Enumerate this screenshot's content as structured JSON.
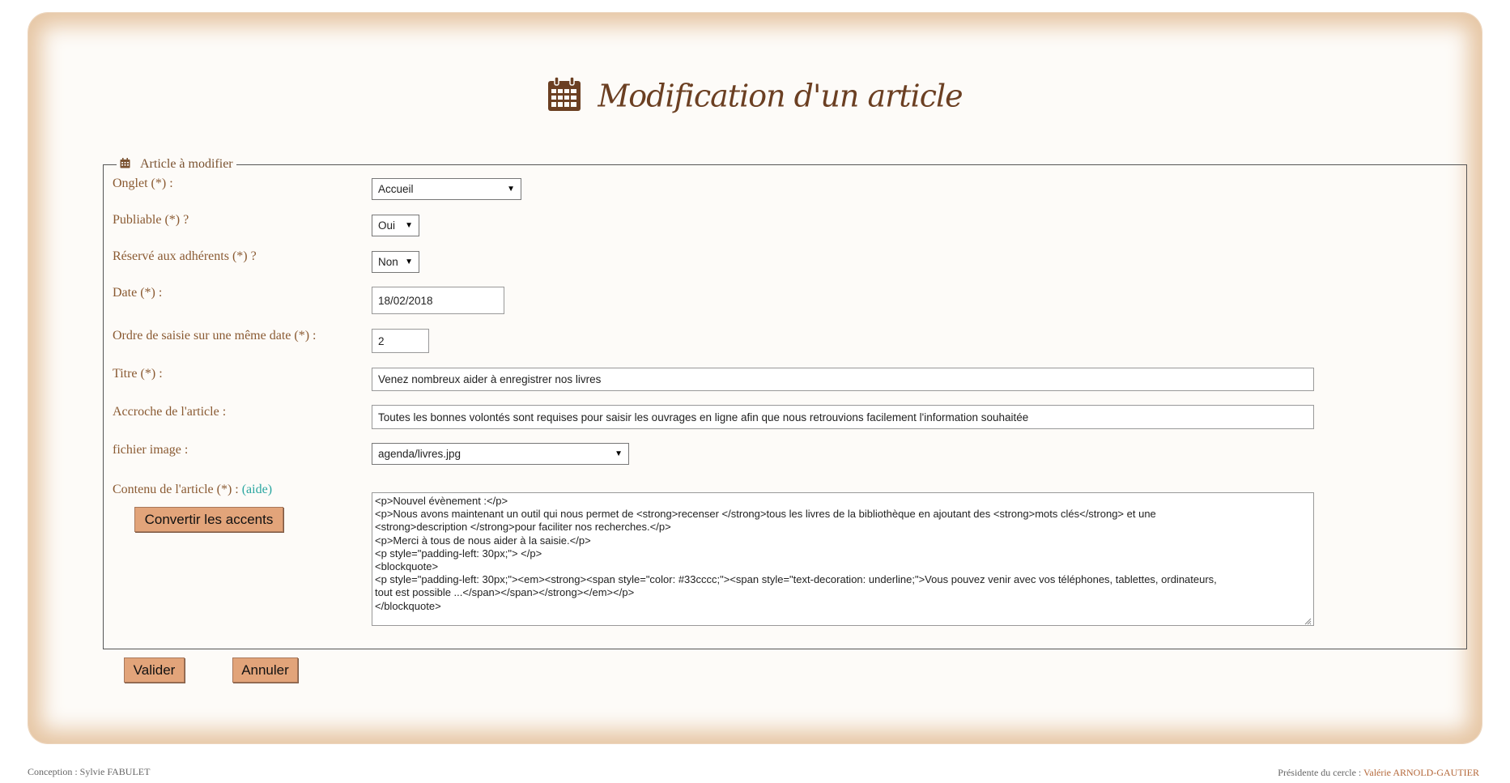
{
  "header": {
    "title": "Modification d'un article",
    "icon": "calendar-icon"
  },
  "fieldset": {
    "legend": "Article à modifier",
    "icon": "calendar-icon"
  },
  "form": {
    "onglet": {
      "label": "Onglet (*) :",
      "value": "Accueil"
    },
    "publiable": {
      "label": "Publiable (*) ?",
      "value": "Oui"
    },
    "reserve": {
      "label": "Réservé aux adhérents (*) ?",
      "value": "Non"
    },
    "date": {
      "label": "Date (*) :",
      "value": "18/02/2018"
    },
    "ordre": {
      "label": "Ordre de saisie sur une même date (*) :",
      "value": "2"
    },
    "titre": {
      "label": "Titre (*) :",
      "value": "Venez nombreux aider à enregistrer nos livres"
    },
    "accroche": {
      "label": "Accroche de l'article :",
      "value": "Toutes les bonnes volontés sont requises pour saisir les ouvrages en ligne afin que nous retrouvions facilement l'information souhaitée"
    },
    "image": {
      "label": "fichier image :",
      "value": "agenda/livres.jpg"
    },
    "contenu": {
      "label": "Contenu de l'article (*) : ",
      "aide": "(aide)",
      "convert_label": "Convertir les accents",
      "lines": [
        "<p>Nouvel évènement :</p>",
        "<p>Nous avons maintenant un outil qui nous permet de <strong>recenser </strong>tous les livres de la bibliothèque en ajoutant des <strong>mots clés</strong> et une",
        "<strong>description </strong>pour faciliter nos recherches.</p>",
        "<p>Merci à tous de nous aider à la saisie.</p>",
        "<p style=\"padding-left: 30px;\"> </p>",
        "<blockquote>",
        "<p style=\"padding-left: 30px;\"><em><strong><span style=\"color: #33cccc;\"><span style=\"text-decoration: underline;\">Vous pouvez venir avec vos téléphones, tablettes, ordinateurs,",
        "tout est possible ...</span></span></strong></em></p>",
        "</blockquote>"
      ]
    }
  },
  "actions": {
    "valider": "Valider",
    "annuler": "Annuler"
  },
  "footer": {
    "conception": "Conception : Sylvie FABULET",
    "president_label": "Présidente du cercle : ",
    "president_name": "Valérie ARNOLD-GAUTIER"
  },
  "colors": {
    "accent": "#e2a47a",
    "title": "#6b3f22",
    "label": "#8a5a32",
    "aide": "#2aa6a0",
    "frame_shadow": "#e6c6a4"
  }
}
